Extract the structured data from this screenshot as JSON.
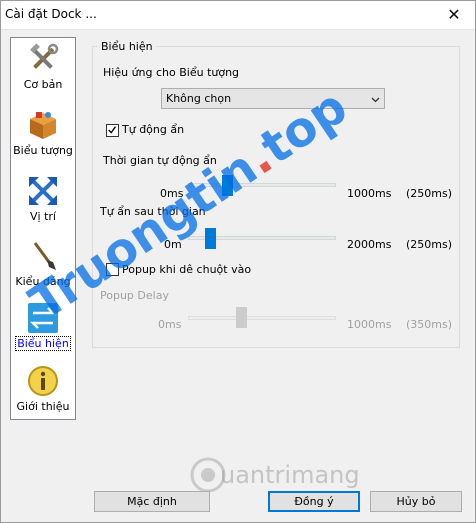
{
  "window": {
    "title": "Cài đặt Dock ...",
    "close_glyph": "✕"
  },
  "sidebar": {
    "items": [
      {
        "label": "Cơ bản",
        "icon": "tools-icon"
      },
      {
        "label": "Biểu tượng",
        "icon": "box-icon"
      },
      {
        "label": "Vị trí",
        "icon": "arrows-icon"
      },
      {
        "label": "Kiểu dáng",
        "icon": "brush-icon"
      },
      {
        "label": "Biểu hiện",
        "icon": "swap-icon",
        "selected": true
      },
      {
        "label": "Giới thiệu",
        "icon": "info-icon"
      }
    ]
  },
  "behavior": {
    "group_title": "Biểu hiện",
    "icon_effect_label": "Hiệu ứng cho Biểu tượng",
    "icon_effect_value": "Không chọn",
    "auto_hide": {
      "label": "Tự động ẩn",
      "checked": true
    },
    "auto_hide_time": {
      "label": "Thời gian tự động ẩn",
      "min": "0ms",
      "max": "1000ms",
      "value_text": "(250ms)",
      "value": 250,
      "range": [
        0,
        1000
      ]
    },
    "hide_delay": {
      "label": "Tự ẩn sau thời gian",
      "min": "0m",
      "max": "2000ms",
      "value_text": "(250ms)",
      "value": 250,
      "range": [
        0,
        2000
      ]
    },
    "popup_on_hover": {
      "label": "Popup khi dê chuột vào",
      "checked": false
    },
    "popup_delay": {
      "label": "Popup Delay",
      "min": "0ms",
      "max": "1000ms",
      "value_text": "(350ms)",
      "value": 350,
      "range": [
        0,
        1000
      ],
      "enabled": false
    }
  },
  "buttons": {
    "default": "Mặc định",
    "ok": "Đồng ý",
    "cancel": "Hủy bỏ"
  },
  "watermarks": {
    "main": "Truongtin",
    "dot": ".",
    "top": "top",
    "secondary": "uantrimang"
  },
  "colors": {
    "accent": "#007ad9",
    "selected_text": "#0000ff"
  }
}
